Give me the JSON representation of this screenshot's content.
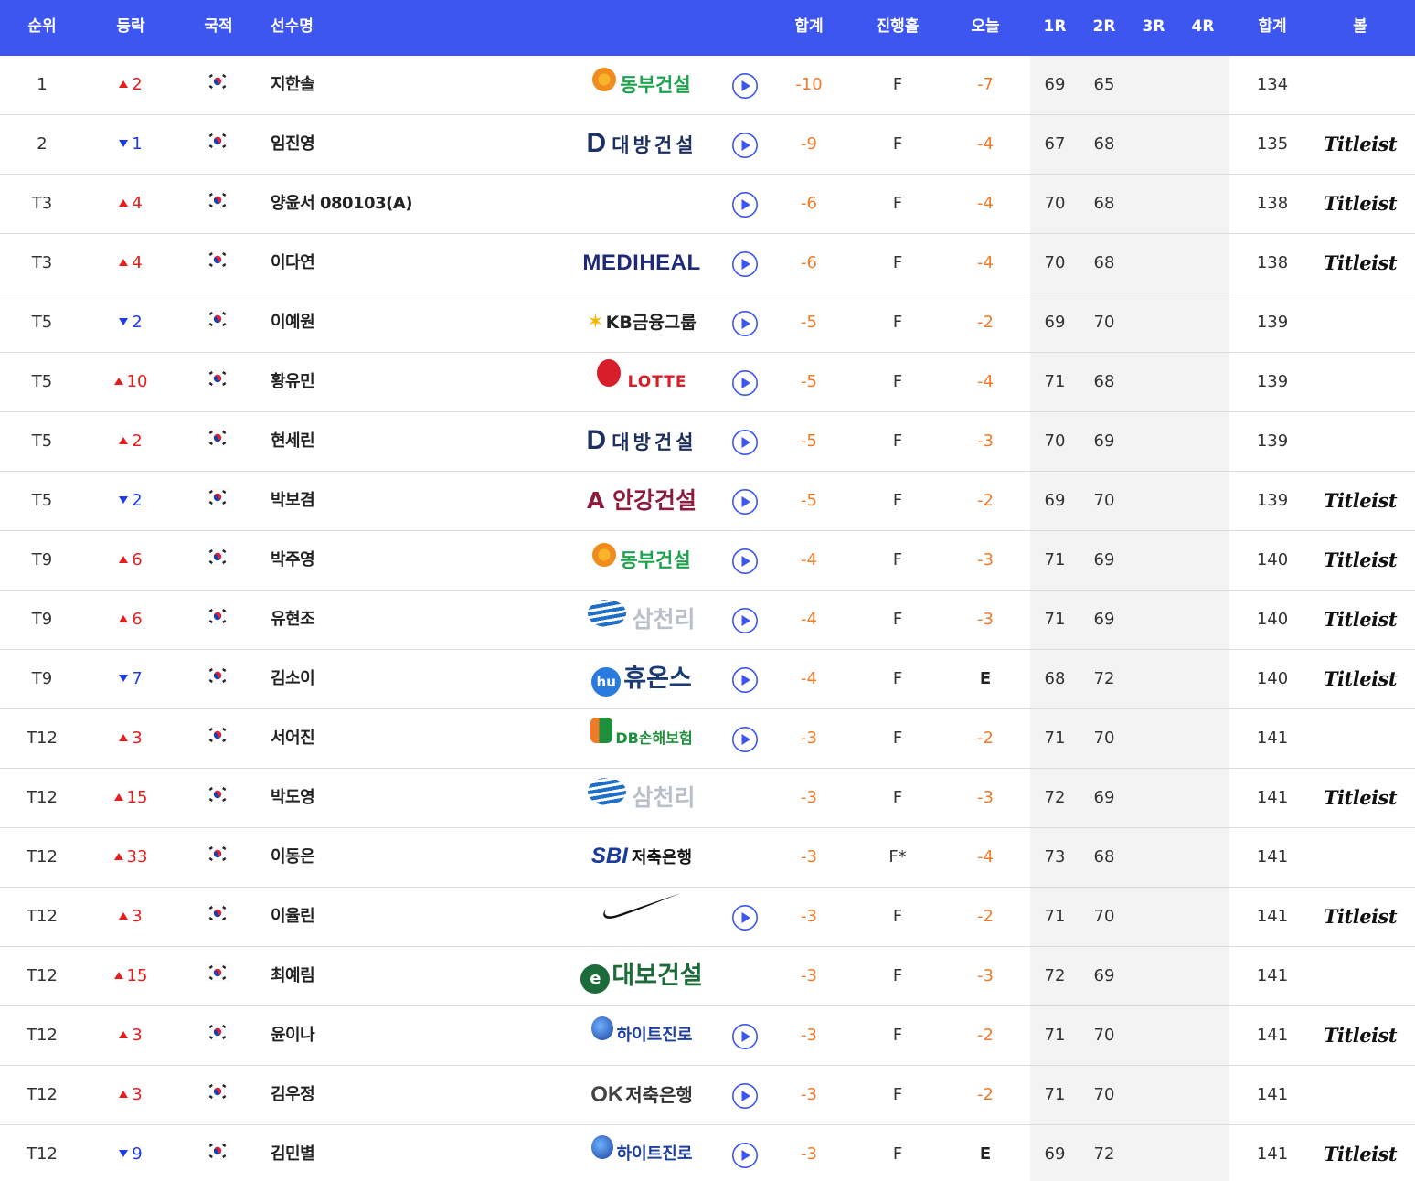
{
  "header": {
    "rank": "순위",
    "change": "등락",
    "nation": "국적",
    "player": "선수명",
    "total": "합계",
    "hole": "진행홀",
    "today": "오늘",
    "r1": "1R",
    "r2": "2R",
    "r3": "3R",
    "r4": "4R",
    "sum": "합계",
    "ball": "볼"
  },
  "colors": {
    "header_bg": "#3d56f0",
    "up": "#e61e1e",
    "down": "#1e3ce6",
    "score": "#f07a28",
    "rounds_bg": "#f3f3f3"
  },
  "rows": [
    {
      "rank": "1",
      "dir": "up",
      "chg": "2",
      "name": "지한솔",
      "sponsor": {
        "type": "orange",
        "text": "동부건설"
      },
      "play": true,
      "total": "-10",
      "hole": "F",
      "today": "-7",
      "r1": "69",
      "r2": "65",
      "r3": "",
      "r4": "",
      "sum": "134",
      "ball": ""
    },
    {
      "rank": "2",
      "dir": "down",
      "chg": "1",
      "name": "임진영",
      "sponsor": {
        "type": "navy",
        "mark": "D",
        "text": "대방건설"
      },
      "play": true,
      "total": "-9",
      "hole": "F",
      "today": "-4",
      "r1": "67",
      "r2": "68",
      "r3": "",
      "r4": "",
      "sum": "135",
      "ball": "Titleist"
    },
    {
      "rank": "T3",
      "dir": "up",
      "chg": "4",
      "name": "양윤서 080103(A)",
      "sponsor": {
        "type": "none",
        "text": ""
      },
      "play": true,
      "total": "-6",
      "hole": "F",
      "today": "-4",
      "r1": "70",
      "r2": "68",
      "r3": "",
      "r4": "",
      "sum": "138",
      "ball": "Titleist"
    },
    {
      "rank": "T3",
      "dir": "up",
      "chg": "4",
      "name": "이다연",
      "sponsor": {
        "type": "medi",
        "text": "MEDIHEAL"
      },
      "play": true,
      "total": "-6",
      "hole": "F",
      "today": "-4",
      "r1": "70",
      "r2": "68",
      "r3": "",
      "r4": "",
      "sum": "138",
      "ball": "Titleist"
    },
    {
      "rank": "T5",
      "dir": "down",
      "chg": "2",
      "name": "이예원",
      "sponsor": {
        "type": "kb",
        "mark": "✶",
        "text": "KB금융그룹"
      },
      "play": true,
      "total": "-5",
      "hole": "F",
      "today": "-2",
      "r1": "69",
      "r2": "70",
      "r3": "",
      "r4": "",
      "sum": "139",
      "ball": ""
    },
    {
      "rank": "T5",
      "dir": "up",
      "chg": "10",
      "name": "황유민",
      "sponsor": {
        "type": "lotte",
        "text": "LOTTE"
      },
      "play": true,
      "total": "-5",
      "hole": "F",
      "today": "-4",
      "r1": "71",
      "r2": "68",
      "r3": "",
      "r4": "",
      "sum": "139",
      "ball": ""
    },
    {
      "rank": "T5",
      "dir": "up",
      "chg": "2",
      "name": "현세린",
      "sponsor": {
        "type": "navy",
        "mark": "D",
        "text": "대방건설"
      },
      "play": true,
      "total": "-5",
      "hole": "F",
      "today": "-3",
      "r1": "70",
      "r2": "69",
      "r3": "",
      "r4": "",
      "sum": "139",
      "ball": ""
    },
    {
      "rank": "T5",
      "dir": "down",
      "chg": "2",
      "name": "박보겸",
      "sponsor": {
        "type": "angang",
        "text": "A 안강건설"
      },
      "play": true,
      "total": "-5",
      "hole": "F",
      "today": "-2",
      "r1": "69",
      "r2": "70",
      "r3": "",
      "r4": "",
      "sum": "139",
      "ball": "Titleist"
    },
    {
      "rank": "T9",
      "dir": "up",
      "chg": "6",
      "name": "박주영",
      "sponsor": {
        "type": "orange",
        "text": "동부건설"
      },
      "play": true,
      "total": "-4",
      "hole": "F",
      "today": "-3",
      "r1": "71",
      "r2": "69",
      "r3": "",
      "r4": "",
      "sum": "140",
      "ball": "Titleist"
    },
    {
      "rank": "T9",
      "dir": "up",
      "chg": "6",
      "name": "유현조",
      "sponsor": {
        "type": "samch",
        "text": "삼천리"
      },
      "play": true,
      "total": "-4",
      "hole": "F",
      "today": "-3",
      "r1": "71",
      "r2": "69",
      "r3": "",
      "r4": "",
      "sum": "140",
      "ball": "Titleist"
    },
    {
      "rank": "T9",
      "dir": "down",
      "chg": "7",
      "name": "김소이",
      "sponsor": {
        "type": "huons",
        "mark": "hu",
        "text": "휴온스"
      },
      "play": true,
      "total": "-4",
      "hole": "F",
      "today": "E",
      "r1": "68",
      "r2": "72",
      "r3": "",
      "r4": "",
      "sum": "140",
      "ball": "Titleist"
    },
    {
      "rank": "T12",
      "dir": "up",
      "chg": "3",
      "name": "서어진",
      "sponsor": {
        "type": "db",
        "text": "DB손해보험"
      },
      "play": true,
      "total": "-3",
      "hole": "F",
      "today": "-2",
      "r1": "71",
      "r2": "70",
      "r3": "",
      "r4": "",
      "sum": "141",
      "ball": ""
    },
    {
      "rank": "T12",
      "dir": "up",
      "chg": "15",
      "name": "박도영",
      "sponsor": {
        "type": "samch",
        "text": "삼천리"
      },
      "play": false,
      "total": "-3",
      "hole": "F",
      "today": "-3",
      "r1": "72",
      "r2": "69",
      "r3": "",
      "r4": "",
      "sum": "141",
      "ball": "Titleist"
    },
    {
      "rank": "T12",
      "dir": "up",
      "chg": "33",
      "name": "이동은",
      "sponsor": {
        "type": "sbi",
        "mark": "SBI",
        "text": "저축은행"
      },
      "play": false,
      "total": "-3",
      "hole": "F*",
      "today": "-4",
      "r1": "73",
      "r2": "68",
      "r3": "",
      "r4": "",
      "sum": "141",
      "ball": ""
    },
    {
      "rank": "T12",
      "dir": "up",
      "chg": "3",
      "name": "이율린",
      "sponsor": {
        "type": "nike",
        "text": ""
      },
      "play": true,
      "total": "-3",
      "hole": "F",
      "today": "-2",
      "r1": "71",
      "r2": "70",
      "r3": "",
      "r4": "",
      "sum": "141",
      "ball": "Titleist"
    },
    {
      "rank": "T12",
      "dir": "up",
      "chg": "15",
      "name": "최예림",
      "sponsor": {
        "type": "daebo",
        "mark": "e",
        "text": "대보건설"
      },
      "play": false,
      "total": "-3",
      "hole": "F",
      "today": "-3",
      "r1": "72",
      "r2": "69",
      "r3": "",
      "r4": "",
      "sum": "141",
      "ball": ""
    },
    {
      "rank": "T12",
      "dir": "up",
      "chg": "3",
      "name": "윤이나",
      "sponsor": {
        "type": "hite",
        "text": "하이트진로"
      },
      "play": true,
      "total": "-3",
      "hole": "F",
      "today": "-2",
      "r1": "71",
      "r2": "70",
      "r3": "",
      "r4": "",
      "sum": "141",
      "ball": "Titleist"
    },
    {
      "rank": "T12",
      "dir": "up",
      "chg": "3",
      "name": "김우정",
      "sponsor": {
        "type": "ok",
        "mark": "OK",
        "text": "저축은행"
      },
      "play": true,
      "total": "-3",
      "hole": "F",
      "today": "-2",
      "r1": "71",
      "r2": "70",
      "r3": "",
      "r4": "",
      "sum": "141",
      "ball": ""
    },
    {
      "rank": "T12",
      "dir": "down",
      "chg": "9",
      "name": "김민별",
      "sponsor": {
        "type": "hite",
        "text": "하이트진로"
      },
      "play": true,
      "total": "-3",
      "hole": "F",
      "today": "E",
      "r1": "69",
      "r2": "72",
      "r3": "",
      "r4": "",
      "sum": "141",
      "ball": "Titleist"
    }
  ]
}
